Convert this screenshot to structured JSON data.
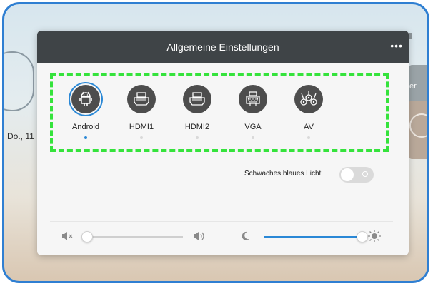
{
  "background": {
    "date_fragment": "Do., 11",
    "side_text": "er"
  },
  "dialog": {
    "title": "Allgemeine Einstellungen",
    "more_label": "•••"
  },
  "sources": [
    {
      "label": "Android",
      "icon": "android-icon",
      "active": true
    },
    {
      "label": "HDMI1",
      "icon": "hdmi-icon",
      "active": false
    },
    {
      "label": "HDMI2",
      "icon": "hdmi-icon",
      "active": false
    },
    {
      "label": "VGA",
      "icon": "vga-icon",
      "active": false
    },
    {
      "label": "AV",
      "icon": "av-icon",
      "active": false
    }
  ],
  "blue_light": {
    "label": "Schwaches blaues Licht",
    "enabled": false
  },
  "volume": {
    "level": 0.0
  },
  "brightness": {
    "level": 1.0
  },
  "colors": {
    "accent": "#2a88d6",
    "highlight_dashes": "#35e33c",
    "titlebar": "#3f4447",
    "frame": "#2f7fd2"
  }
}
